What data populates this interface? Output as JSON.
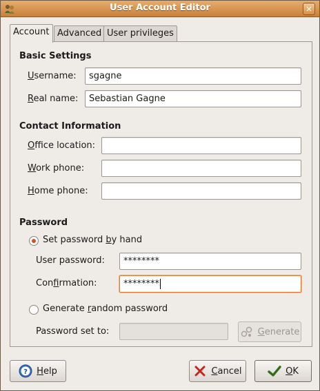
{
  "window": {
    "title": "User Account Editor",
    "close_glyph": "✕"
  },
  "tabs": [
    {
      "label": "Account",
      "active": true
    },
    {
      "label": "Advanced",
      "active": false
    },
    {
      "label": "User privileges",
      "active": false
    }
  ],
  "basic": {
    "title": "Basic Settings",
    "username": {
      "label_mn": "U",
      "label_rest": "sername:",
      "value": "sgagne"
    },
    "realname": {
      "label_mn": "R",
      "label_rest": "eal name:",
      "value": "Sebastian Gagne"
    }
  },
  "contact": {
    "title": "Contact Information",
    "office": {
      "label_mn": "O",
      "label_rest": "ffice location:",
      "value": ""
    },
    "work": {
      "label_mn": "W",
      "label_rest": "ork phone:",
      "value": ""
    },
    "home": {
      "label_mn": "H",
      "label_rest": "ome phone:",
      "value": ""
    }
  },
  "password": {
    "title": "Password",
    "by_hand": {
      "label_pre": "Set password ",
      "label_mn": "b",
      "label_post": "y hand",
      "checked": true
    },
    "user_password": {
      "label": "User password:",
      "value": "********"
    },
    "confirmation": {
      "label_pre": "Con",
      "label_mn": "f",
      "label_post": "irmation:",
      "value": "********"
    },
    "generate_random": {
      "label_pre": "Generate ",
      "label_mn": "r",
      "label_post": "andom password",
      "checked": false
    },
    "set_to": {
      "label": "Password set to:",
      "value": ""
    },
    "generate_button": {
      "label_mn": "G",
      "label_rest": "enerate"
    }
  },
  "buttons": {
    "help": {
      "label_mn": "H",
      "label_rest": "elp"
    },
    "cancel": {
      "label_mn": "C",
      "label_rest": "ancel"
    },
    "ok": {
      "label_mn": "O",
      "label_rest": "K"
    }
  },
  "colors": {
    "titlebar": "#c9803b",
    "focus": "#e27a31",
    "radio_selected": "#d5521f"
  }
}
